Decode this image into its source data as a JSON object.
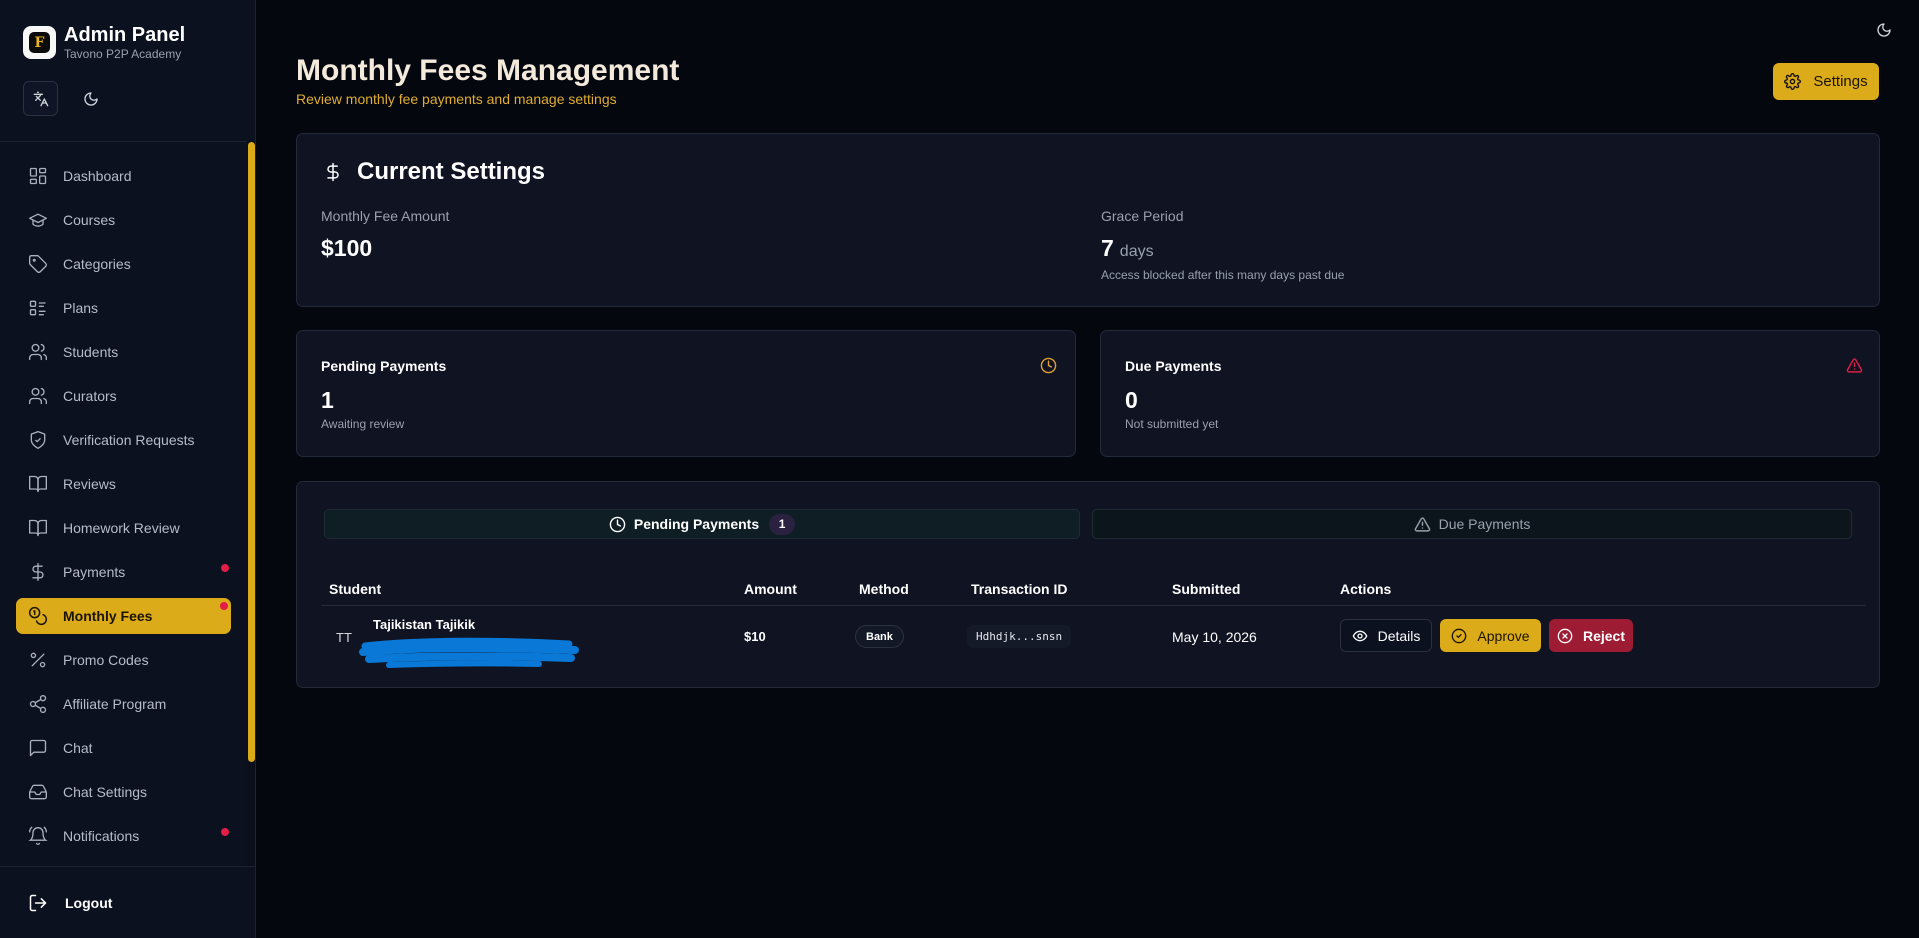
{
  "sidebar": {
    "brand_title": "Admin Panel",
    "brand_subtitle": "Tavono P2P Academy",
    "items": [
      {
        "label": "Dashboard",
        "icon": "dashboard-icon"
      },
      {
        "label": "Courses",
        "icon": "graduation-cap-icon"
      },
      {
        "label": "Categories",
        "icon": "tag-icon"
      },
      {
        "label": "Plans",
        "icon": "list-icon"
      },
      {
        "label": "Students",
        "icon": "users-icon"
      },
      {
        "label": "Curators",
        "icon": "users-icon"
      },
      {
        "label": "Verification Requests",
        "icon": "shield-check-icon"
      },
      {
        "label": "Reviews",
        "icon": "book-open-icon"
      },
      {
        "label": "Homework Review",
        "icon": "book-open-icon"
      },
      {
        "label": "Payments",
        "icon": "dollar-icon",
        "notification": true
      },
      {
        "label": "Monthly Fees",
        "icon": "coins-icon",
        "active": true,
        "notification": true
      },
      {
        "label": "Promo Codes",
        "icon": "percent-icon"
      },
      {
        "label": "Affiliate Program",
        "icon": "share-icon"
      },
      {
        "label": "Chat",
        "icon": "message-square-icon"
      },
      {
        "label": "Chat Settings",
        "icon": "inbox-icon"
      },
      {
        "label": "Notifications",
        "icon": "bell-icon",
        "notification": true
      }
    ],
    "logout_label": "Logout"
  },
  "header": {
    "title": "Monthly Fees Management",
    "subtitle": "Review monthly fee payments and manage settings",
    "settings_label": "Settings"
  },
  "current_settings": {
    "title": "Current Settings",
    "fee_label": "Monthly Fee Amount",
    "fee_value": "$100",
    "grace_label": "Grace Period",
    "grace_value": "7",
    "grace_unit": "days",
    "grace_note": "Access blocked after this many days past due"
  },
  "stats": {
    "pending": {
      "title": "Pending Payments",
      "value": "1",
      "subtitle": "Awaiting review"
    },
    "due": {
      "title": "Due Payments",
      "value": "0",
      "subtitle": "Not submitted yet"
    }
  },
  "tabs": {
    "pending_label": "Pending Payments",
    "pending_count": "1",
    "due_label": "Due Payments"
  },
  "table": {
    "columns": [
      "Student",
      "Amount",
      "Method",
      "Transaction ID",
      "Submitted",
      "Actions"
    ],
    "rows": [
      {
        "initials": "TT",
        "student": "Tajikistan Tajikik",
        "amount": "$10",
        "method": "Bank",
        "transaction_id": "Hdhdjk...snsn",
        "submitted": "May 10, 2026"
      }
    ],
    "actions": {
      "details": "Details",
      "approve": "Approve",
      "reject": "Reject"
    }
  },
  "colors": {
    "accent": "#dcab19",
    "background": "#05070f",
    "danger": "#9d1b33",
    "warning": "#e0a032"
  }
}
